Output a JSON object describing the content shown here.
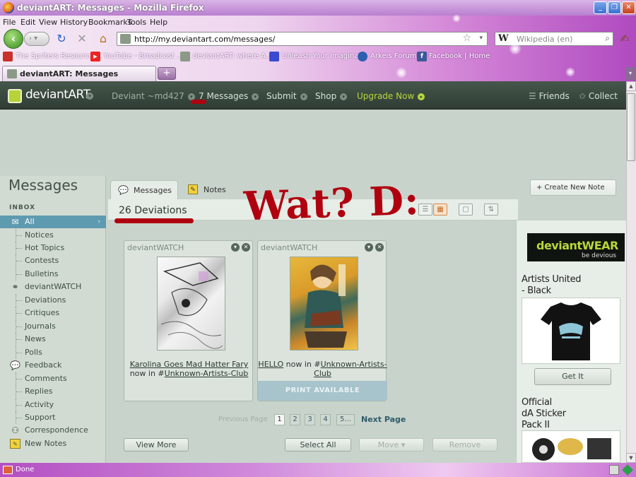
{
  "window": {
    "title": "deviantART: Messages - Mozilla Firefox"
  },
  "menu": [
    "File",
    "Edit",
    "View",
    "History",
    "Bookmarks",
    "Tools",
    "Help"
  ],
  "nav": {
    "url": "http://my.deviantart.com/messages/",
    "search_placeholder": "Wikipedia (en)",
    "search_engine": "W"
  },
  "bookmarks": [
    "The Spriters Resource...",
    "YouTube - Broadcast ...",
    "deviantART: where A...",
    "Unleash Your Imagina...",
    "Arkeis Forums",
    "Facebook | Home"
  ],
  "browser_tab": {
    "label": "deviantART: Messages"
  },
  "da_header": {
    "logo": "deviantART",
    "user": "Deviant ~md427",
    "messages": "7 Messages",
    "submit": "Submit",
    "shop": "Shop",
    "upgrade": "Upgrade Now",
    "friends": "Friends",
    "collect": "Collect"
  },
  "sidebar": {
    "title": "Messages",
    "inbox_label": "INBOX",
    "items": [
      {
        "label": "All",
        "icon": "all-messages-icon"
      },
      {
        "label": "Notices"
      },
      {
        "label": "Hot Topics"
      },
      {
        "label": "Contests"
      },
      {
        "label": "Bulletins"
      },
      {
        "label": "deviantWATCH",
        "icon": "binoculars-icon"
      },
      {
        "label": "Deviations"
      },
      {
        "label": "Critiques"
      },
      {
        "label": "Journals"
      },
      {
        "label": "News"
      },
      {
        "label": "Polls"
      },
      {
        "label": "Feedback",
        "icon": "feedback-icon"
      },
      {
        "label": "Comments"
      },
      {
        "label": "Replies"
      },
      {
        "label": "Activity"
      },
      {
        "label": "Support"
      },
      {
        "label": "Correspondence",
        "icon": "correspondence-icon"
      },
      {
        "label": "New Notes",
        "icon": "notes-icon"
      }
    ]
  },
  "tabs": {
    "messages": "Messages",
    "notes": "Notes",
    "create_note": "+ Create New Note"
  },
  "content": {
    "deviation_count": "26 Deviations",
    "cards": [
      {
        "source": "deviantWATCH",
        "title": "Karolina Goes Mad Hatter Fary",
        "in_text": "now in #",
        "group": "Unknown-Artists-Club"
      },
      {
        "source": "deviantWATCH",
        "title": "HELLO",
        "in_text": " now in #",
        "group": "Unknown-Artists-Club",
        "print": "PRINT AVAILABLE"
      }
    ],
    "pagination": {
      "prev": "Previous Page",
      "pages": [
        "1",
        "2",
        "3",
        "4",
        "5..."
      ],
      "current": "1",
      "next": "Next Page"
    },
    "actions": {
      "view_more": "View More",
      "select_all": "Select All",
      "move": "Move ▾",
      "remove": "Remove"
    }
  },
  "ads": {
    "brand": "deviantWEAR",
    "tagline": "be devious",
    "item1_title": "Artists United - Black",
    "item1_line1": "Artists United",
    "item1_line2": "- Black",
    "item1_button": "Get It",
    "item2_line1": "Official",
    "item2_line2": "dA Sticker",
    "item2_line3": "Pack II"
  },
  "status": {
    "text": "Done"
  },
  "annotation": {
    "text": "Wat? D:"
  },
  "colors": {
    "annotation": "#b00010",
    "da_header": "#3b4a40",
    "selected": "#5e9ab0",
    "accent_green": "#b7d73a"
  }
}
